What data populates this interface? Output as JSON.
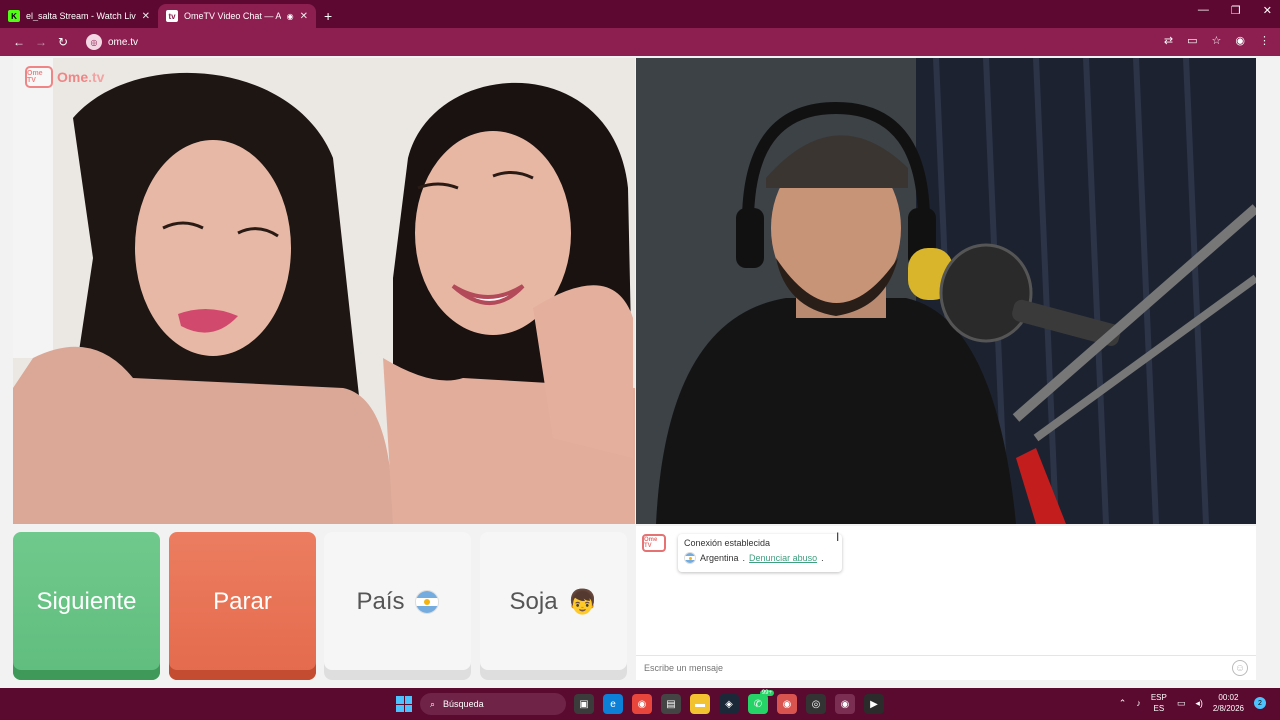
{
  "browser": {
    "tabs": [
      {
        "title": "el_salta Stream - Watch Live on Kick",
        "favicon": "kick-icon",
        "active": false
      },
      {
        "title": "OmeTV Video Chat — Alternative",
        "favicon": "ometv-icon",
        "active": true
      }
    ],
    "new_tab_symbol": "+",
    "url": "ome.tv",
    "favicon_letters": {
      "kick": "K",
      "ome": "tv"
    }
  },
  "page": {
    "logo": {
      "name": "Ome",
      "suffix": ".tv",
      "badge": "Ome TV"
    },
    "buttons": {
      "next": "Siguiente",
      "stop": "Parar",
      "country": "País",
      "gender": "Soja",
      "gender_emoji": "👦"
    },
    "chat": {
      "badge": "Ome TV",
      "message_title": "Conexión establecida",
      "country": "Argentina",
      "separator": " .",
      "report_link": "Denunciar abuso",
      "period": ".",
      "input_placeholder": "Escribe un mensaje"
    }
  },
  "taskbar": {
    "search_label": "Búsqueda",
    "lang_top": "ESP",
    "lang_bottom": "ES",
    "time": "00:02",
    "date": "2/8/2026",
    "whatsapp_badge": "99+",
    "notif_count": "2"
  },
  "colors": {
    "chrome_dark": "#5c0830",
    "chrome_active": "#8c1f50",
    "next_green": "#5fbd7d",
    "stop_orange": "#e46a4c",
    "link_green": "#3f9f7f"
  }
}
